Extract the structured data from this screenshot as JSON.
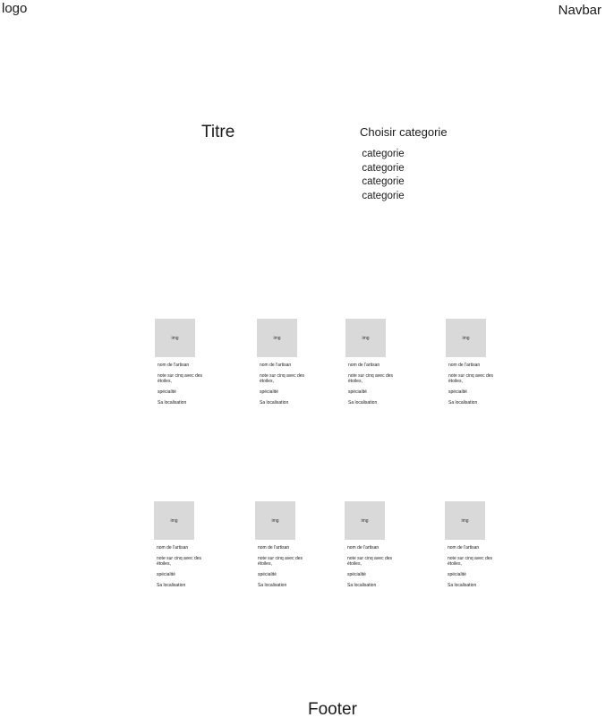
{
  "header": {
    "logo": "logo",
    "navbar": "Navbar"
  },
  "main": {
    "title": "Titre",
    "category_menu": {
      "label": "Choisir categorie",
      "options": [
        "categorie",
        "categorie",
        "categorie",
        "categorie"
      ]
    },
    "artisans": [
      {
        "img_label": "img",
        "name": "nom de l'artisan",
        "rating": "note sur cinq avec des étoiles,",
        "specialty": "spécialité",
        "location": "Sa localisation"
      },
      {
        "img_label": "img",
        "name": "nom de l'artisan",
        "rating": "note sur cinq avec des étoiles,",
        "specialty": "spécialité",
        "location": "Sa localisation"
      },
      {
        "img_label": "img",
        "name": "nom de l'artisan",
        "rating": "note sur cinq avec des étoiles,",
        "specialty": "spécialité",
        "location": "Sa localisation"
      },
      {
        "img_label": "img",
        "name": "nom de l'artisan",
        "rating": "note sur cinq avec des étoiles,",
        "specialty": "spécialité",
        "location": "Sa localisation"
      },
      {
        "img_label": "img",
        "name": "nom de l'artisan",
        "rating": "note sur cinq avec des étoiles,",
        "specialty": "spécialité",
        "location": "Sa localisation"
      },
      {
        "img_label": "img",
        "name": "nom de l'artisan",
        "rating": "note sur cinq avec des étoiles,",
        "specialty": "spécialité",
        "location": "Sa localisation"
      },
      {
        "img_label": "img",
        "name": "nom de l'artisan",
        "rating": "note sur cinq avec des étoiles,",
        "specialty": "spécialité",
        "location": "Sa localisation"
      },
      {
        "img_label": "img",
        "name": "nom de l'artisan",
        "rating": "note sur cinq avec des étoiles,",
        "specialty": "spécialité",
        "location": "Sa localisation"
      }
    ]
  },
  "footer": {
    "label": "Footer"
  }
}
